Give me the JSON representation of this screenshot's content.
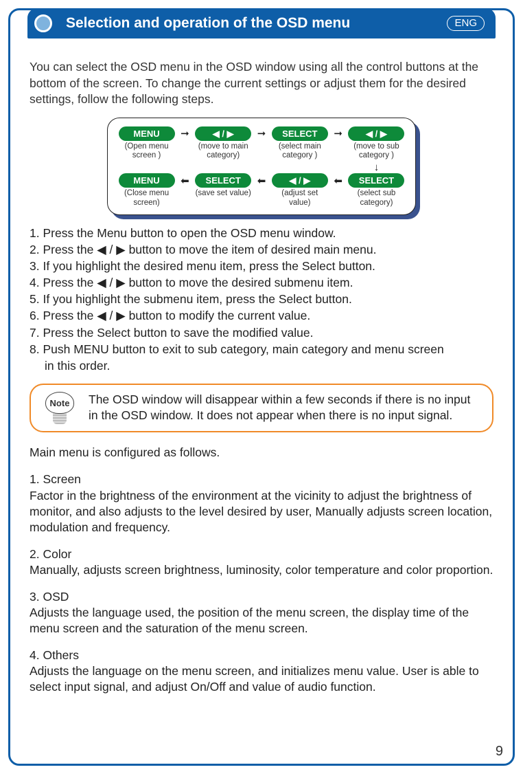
{
  "header": {
    "title": "Selection and operation of the OSD menu",
    "lang": "ENG"
  },
  "intro": "You can select the OSD menu in the OSD window using all the control buttons at the bottom of the screen. To change the current settings or adjust them for the desired settings, follow the following steps.",
  "diagram": {
    "top": [
      {
        "pill": "MENU",
        "arrows": false,
        "cap": "(Open menu screen )"
      },
      {
        "pill": "◀ / ▶",
        "arrows": true,
        "cap": "(move to main category)"
      },
      {
        "pill": "SELECT",
        "arrows": false,
        "cap": "(select main category )"
      },
      {
        "pill": "◀ / ▶",
        "arrows": true,
        "cap": "(move to sub category )"
      }
    ],
    "bottom": [
      {
        "pill": "MENU",
        "arrows": false,
        "cap": "(Close menu screen)"
      },
      {
        "pill": "SELECT",
        "arrows": false,
        "cap": "(save set value)"
      },
      {
        "pill": "◀ / ▶",
        "arrows": true,
        "cap": "(adjust set value)"
      },
      {
        "pill": "SELECT",
        "arrows": false,
        "cap": "(select sub category)"
      }
    ]
  },
  "steps": [
    "1. Press the Menu button to open the OSD menu window.",
    "2. Press the ◀ / ▶  button to move the item of desired main menu.",
    "3. If you highlight the desired menu item, press the Select button.",
    "4. Press the ◀ / ▶  button to move the desired submenu item.",
    "5. If you highlight the submenu item, press the Select button.",
    "6. Press the ◀ / ▶  button to modify the current value.",
    "7. Press the Select button to save the modified value.",
    "8. Push MENU button to exit to sub category, main category and menu screen",
    "    in this order."
  ],
  "note": {
    "label": "Note",
    "text": "The OSD window will disappear within a few seconds if there is no input in the OSD window. It does not appear when there is no input signal."
  },
  "mainConfigured": "Main menu is configured as follows.",
  "sections": [
    {
      "title": "1. Screen",
      "body": "Factor in the brightness of the environment at the vicinity to adjust the brightness of monitor, and also adjusts to the level desired by user, Manually adjusts screen location, modulation and frequency."
    },
    {
      "title": "2. Color",
      "body": "Manually, adjusts screen brightness, luminosity, color temperature and  color proportion."
    },
    {
      "title": "3. OSD",
      "body": "Adjusts the language used, the position of the menu screen, the display time of the menu screen and the saturation of the menu screen."
    },
    {
      "title": "4. Others",
      "body": "Adjusts the language on the menu screen, and initializes menu value.  User is able to select input signal, and adjust On/Off and value of audio function."
    }
  ],
  "pageNumber": "9"
}
